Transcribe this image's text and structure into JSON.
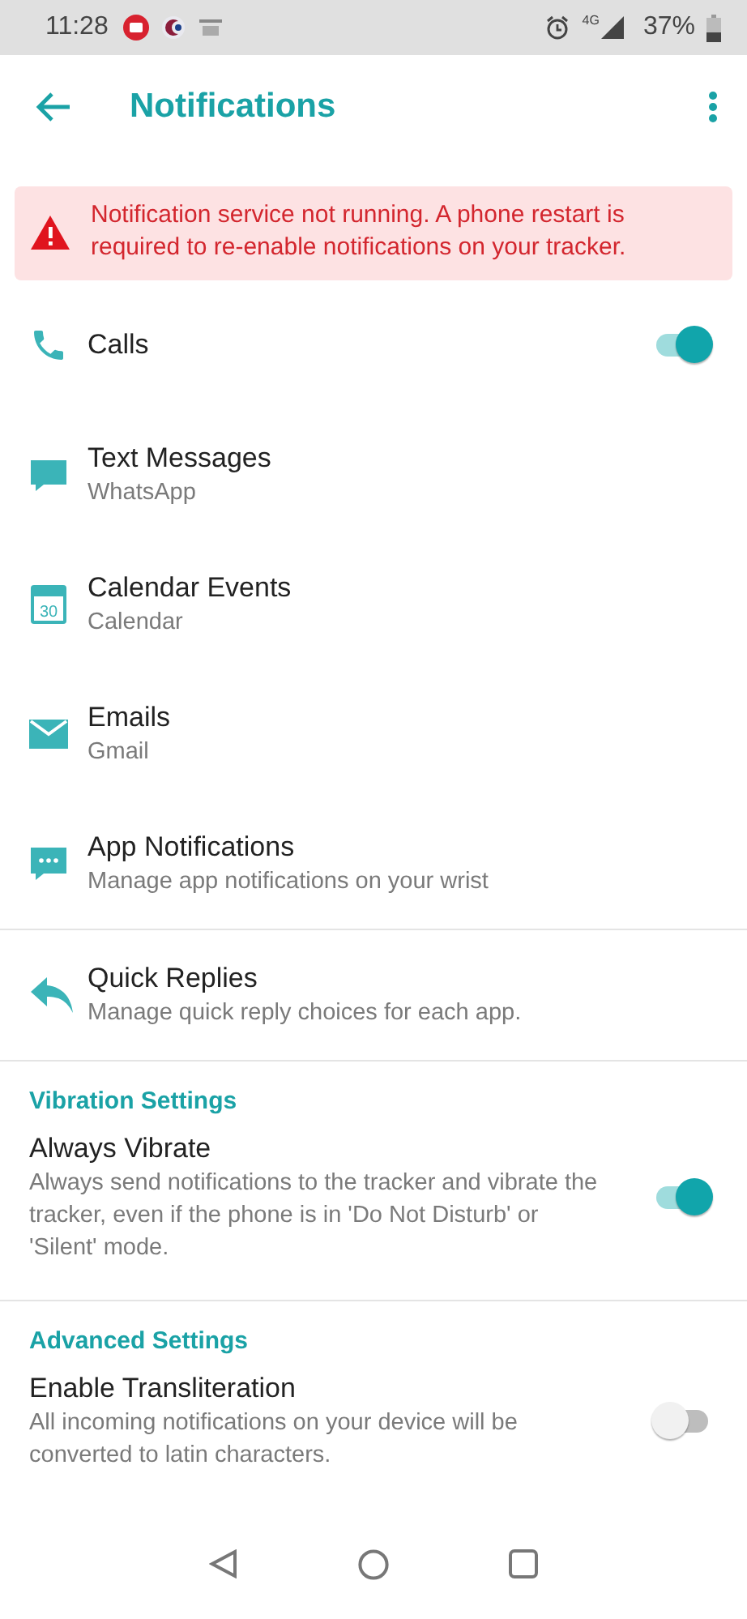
{
  "status_bar": {
    "time": "11:28",
    "network": "4G",
    "battery": "37%"
  },
  "header": {
    "title": "Notifications"
  },
  "alert": {
    "text": "Notification service not running. A phone restart is required to re-enable notifications on your tracker."
  },
  "groups": [
    {
      "items": [
        {
          "title": "Calls",
          "kind": "toggle",
          "on": true
        },
        {
          "title": "Text Messages",
          "subtitle": "WhatsApp",
          "kind": "link"
        },
        {
          "title": "Calendar Events",
          "subtitle": "Calendar",
          "kind": "link",
          "icon_text": "30"
        },
        {
          "title": "Emails",
          "subtitle": "Gmail",
          "kind": "link"
        },
        {
          "title": "App Notifications",
          "subtitle": "Manage app notifications on your wrist",
          "kind": "link"
        }
      ]
    },
    {
      "items": [
        {
          "title": "Quick Replies",
          "subtitle": "Manage quick reply choices for each app.",
          "kind": "link"
        }
      ]
    },
    {
      "heading": "Vibration Settings",
      "items": [
        {
          "title": "Always Vibrate",
          "subtitle": "Always send notifications to the tracker and vibrate the tracker, even if the phone is in 'Do Not Disturb' or 'Silent' mode.",
          "kind": "toggle",
          "on": true
        }
      ]
    },
    {
      "heading": "Advanced Settings",
      "items": [
        {
          "title": "Enable Transliteration",
          "subtitle": "All incoming notifications on your device will be converted to latin characters.",
          "kind": "toggle",
          "on": false
        }
      ]
    }
  ]
}
